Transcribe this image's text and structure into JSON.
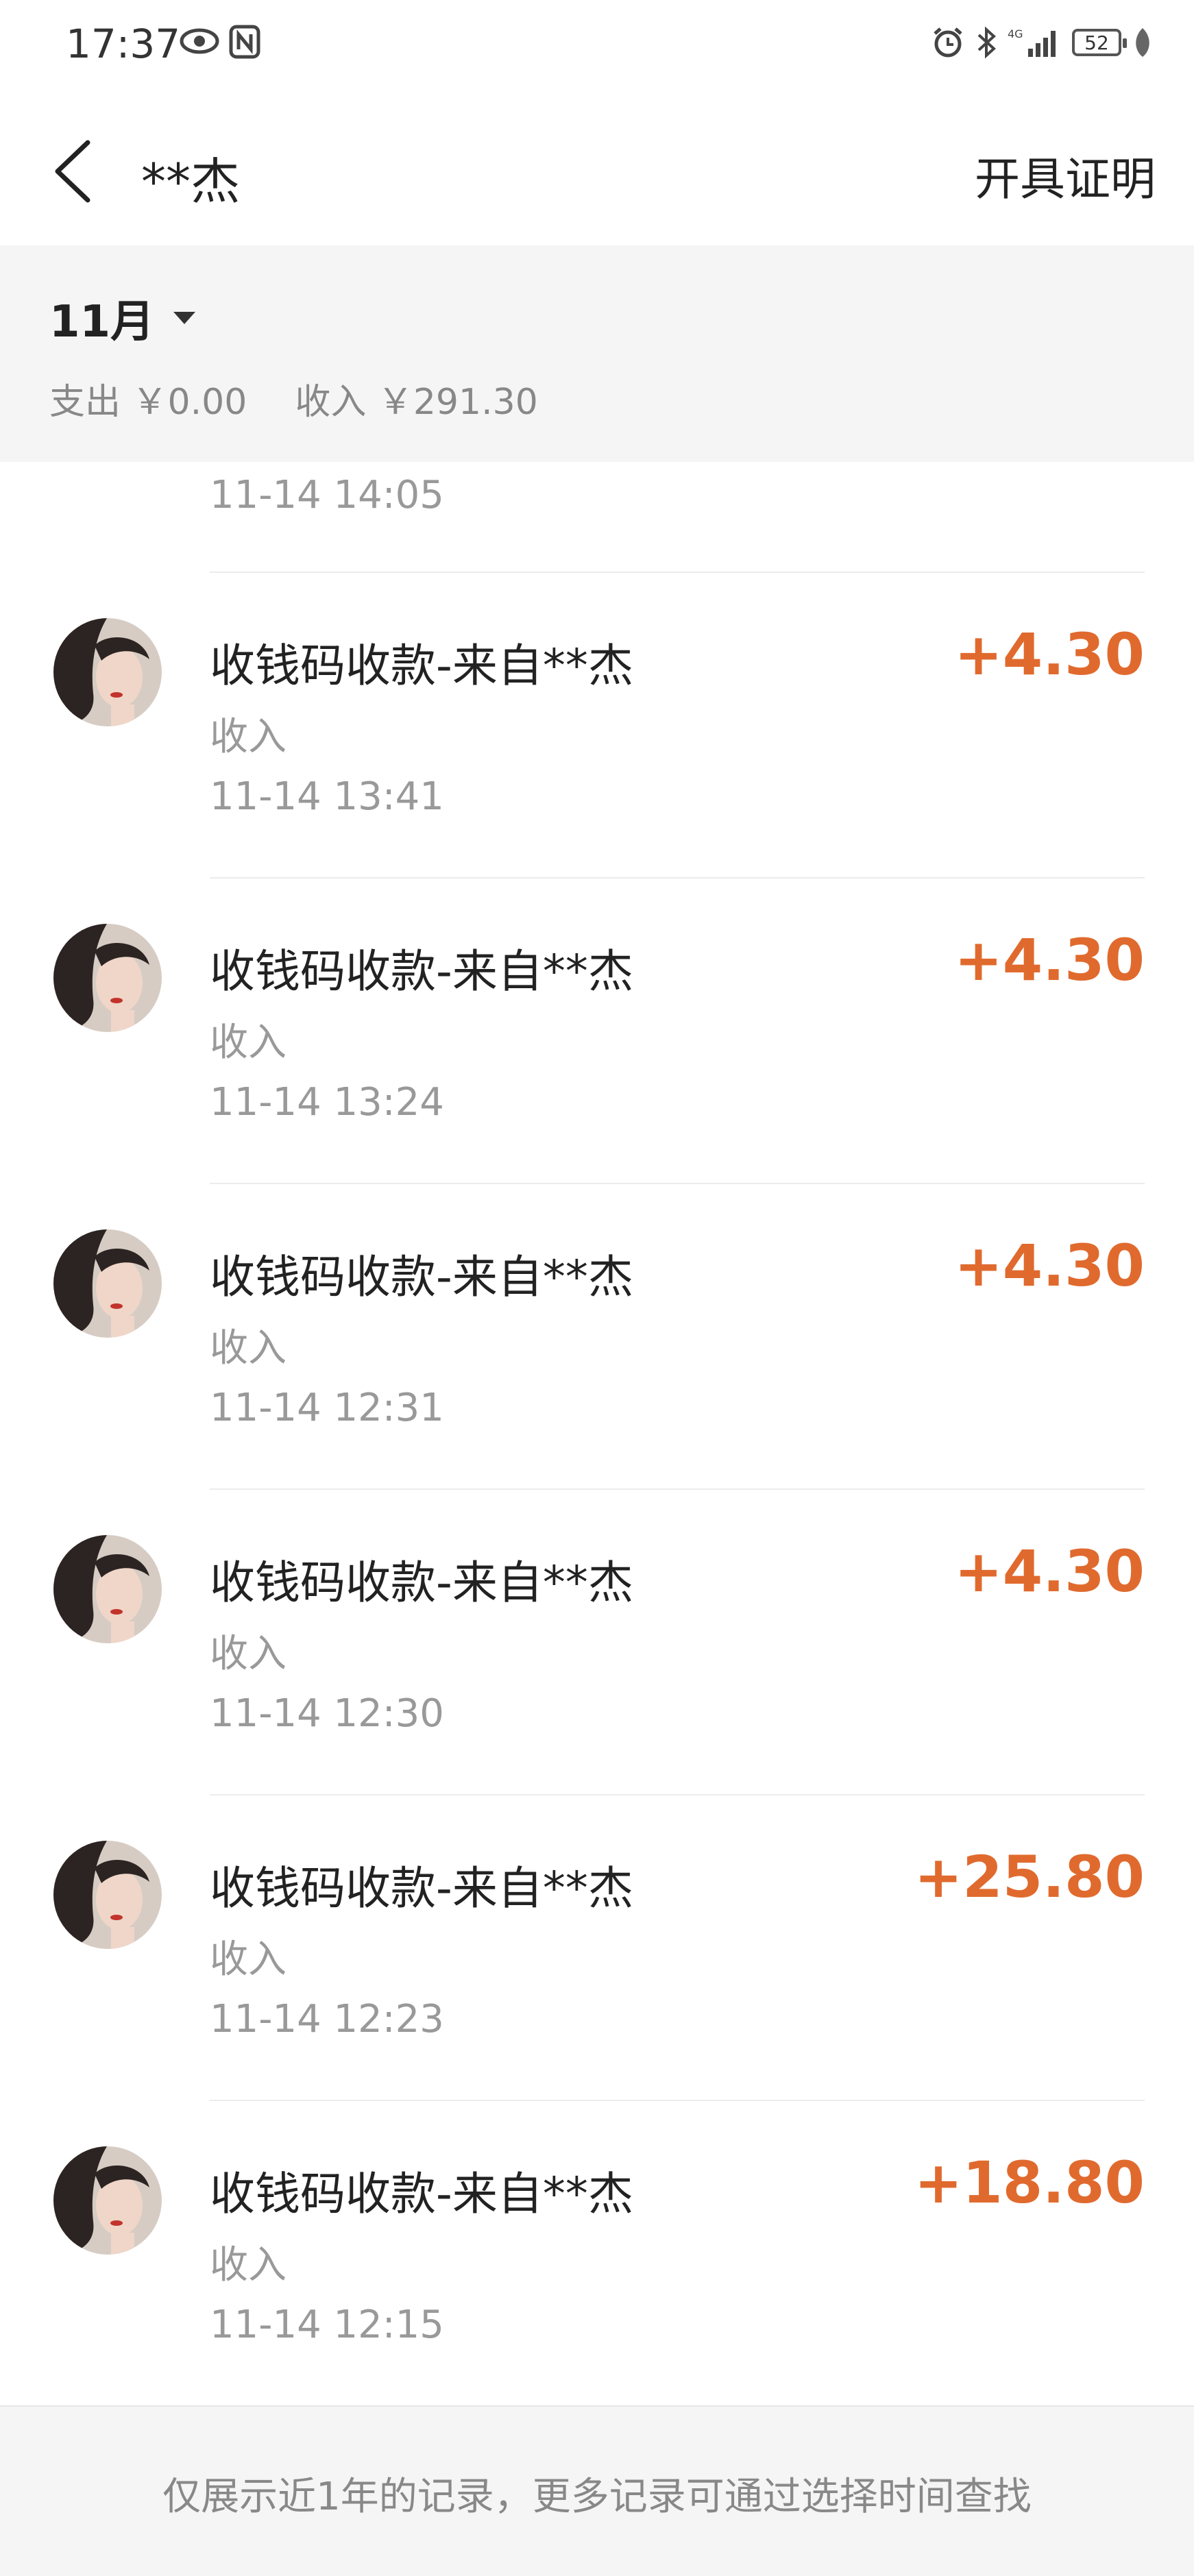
{
  "status_bar": {
    "time": "17:37",
    "battery": "52",
    "network": "4G",
    "icons": [
      "eye-icon",
      "nfc-icon",
      "alarm-icon",
      "bluetooth-icon",
      "signal-icon",
      "battery-icon",
      "leaf-icon"
    ]
  },
  "nav": {
    "back_icon": "chevron-left-icon",
    "title": "**杰",
    "action_label": "开具证明"
  },
  "month_header": {
    "month": "11月",
    "expense": "支出 ￥0.00",
    "income": "收入 ￥291.30"
  },
  "partial_row": {
    "time": "11-14  14:05"
  },
  "transactions": [
    {
      "title": "收钱码收款-来自**杰",
      "type": "收入",
      "time": "11-14  13:41",
      "amount": "+4.30"
    },
    {
      "title": "收钱码收款-来自**杰",
      "type": "收入",
      "time": "11-14  13:24",
      "amount": "+4.30"
    },
    {
      "title": "收钱码收款-来自**杰",
      "type": "收入",
      "time": "11-14  12:31",
      "amount": "+4.30"
    },
    {
      "title": "收钱码收款-来自**杰",
      "type": "收入",
      "time": "11-14  12:30",
      "amount": "+4.30"
    },
    {
      "title": "收钱码收款-来自**杰",
      "type": "收入",
      "time": "11-14  12:23",
      "amount": "+25.80"
    },
    {
      "title": "收钱码收款-来自**杰",
      "type": "收入",
      "time": "11-14  12:15",
      "amount": "+18.80"
    }
  ],
  "footer": {
    "note": "仅展示近1年的记录，更多记录可通过选择时间查找"
  },
  "colors": {
    "amount": "#e06a2e",
    "header_bg": "#f5f5f5",
    "secondary_text": "#999999"
  }
}
